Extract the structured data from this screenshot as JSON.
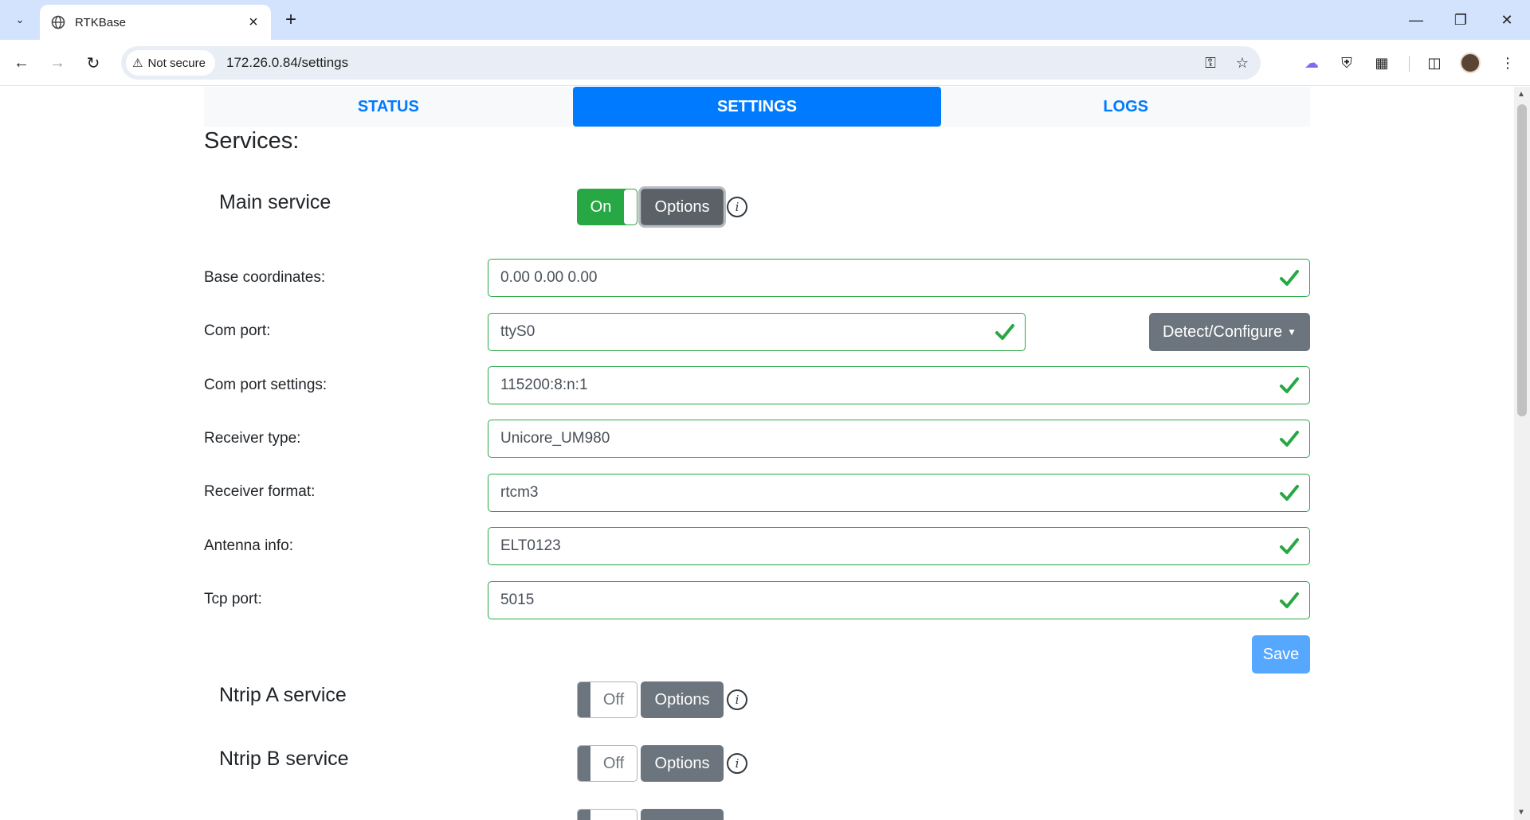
{
  "browser": {
    "tab_title": "RTKBase",
    "security_label": "Not secure",
    "url": "172.26.0.84/settings"
  },
  "nav": {
    "tabs": [
      {
        "label": "STATUS"
      },
      {
        "label": "SETTINGS"
      },
      {
        "label": "LOGS"
      }
    ]
  },
  "services": {
    "title": "Services:",
    "main": {
      "label": "Main service",
      "toggle_label": "On",
      "options_label": "Options"
    },
    "ntrip_a": {
      "label": "Ntrip A service",
      "toggle_label": "Off",
      "options_label": "Options"
    },
    "ntrip_b": {
      "label": "Ntrip B service",
      "toggle_label": "Off",
      "options_label": "Options"
    }
  },
  "main_settings": {
    "fields": [
      {
        "label": "Base coordinates:",
        "value": "0.00 0.00 0.00"
      },
      {
        "label": "Com port:",
        "value": "ttyS0"
      },
      {
        "label": "Com port settings:",
        "value": "115200:8:n:1"
      },
      {
        "label": "Receiver type:",
        "value": "Unicore_UM980"
      },
      {
        "label": "Receiver format:",
        "value": "rtcm3"
      },
      {
        "label": "Antenna info:",
        "value": "ELT0123"
      },
      {
        "label": "Tcp port:",
        "value": "5015"
      }
    ],
    "detect_label": "Detect/Configure",
    "save_label": "Save"
  },
  "colors": {
    "accent": "#007bff",
    "success": "#28a745",
    "secondary": "#6c757d"
  }
}
